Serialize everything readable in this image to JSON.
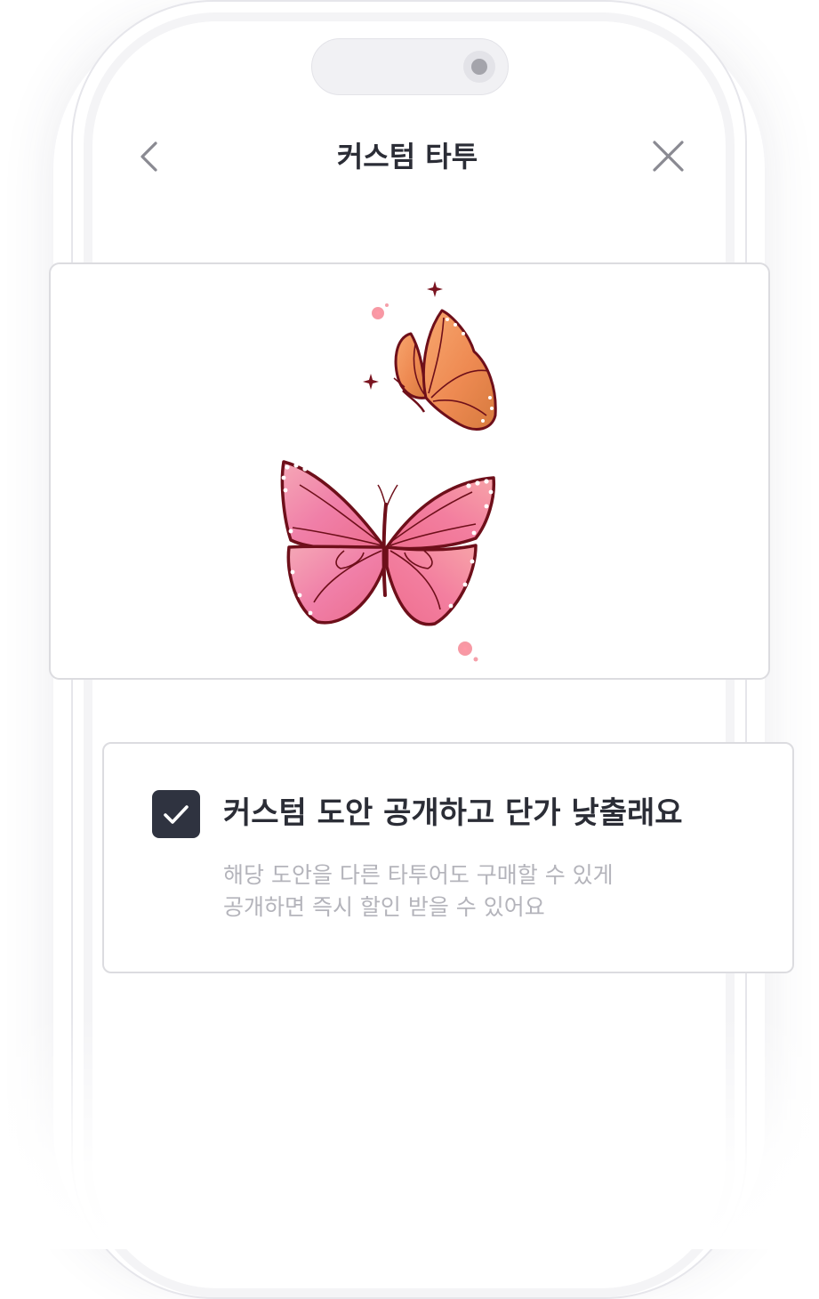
{
  "header": {
    "title": "커스텀 타투",
    "back_icon": "chevron-left-icon",
    "close_icon": "close-icon"
  },
  "preview": {
    "image": "butterfly-tattoo-design"
  },
  "option": {
    "checked": true,
    "title": "커스텀 도안 공개하고 단가 낮출래요",
    "description_lines": [
      "해당 도안을 다른 타투어도 구매할 수 있게",
      "공개하면 즉시 할인 받을 수 있어요"
    ]
  },
  "colors": {
    "text_primary": "#2b2d36",
    "text_secondary": "#b4b4bb",
    "checkbox": "#2f3340",
    "border": "#dcdce0"
  }
}
